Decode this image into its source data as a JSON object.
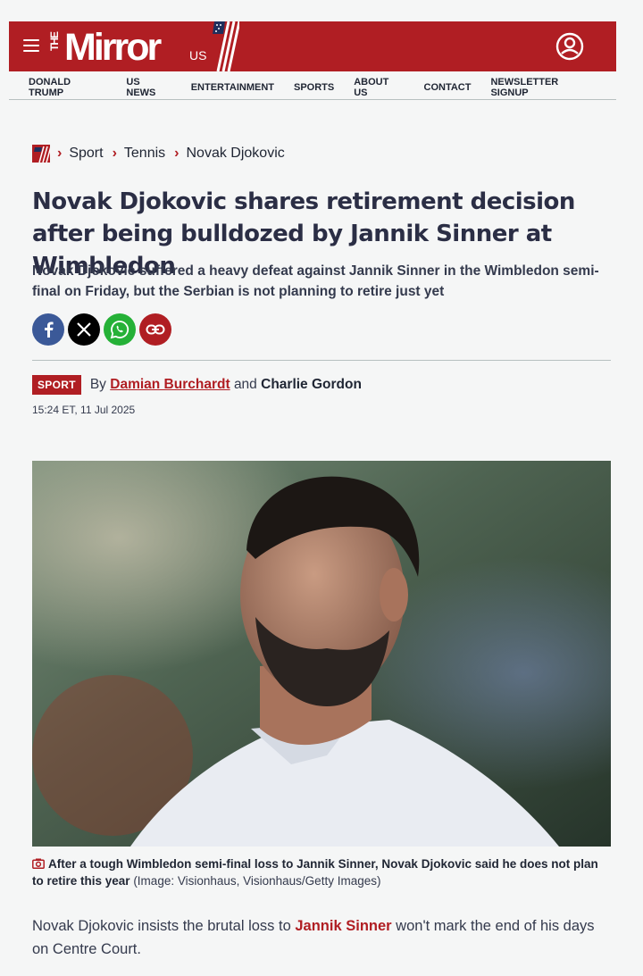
{
  "brand": {
    "logo_the": "THE",
    "logo_main": "Mirror",
    "logo_suffix": "US",
    "accent_color": "#b01e23"
  },
  "icons": {
    "menu": "hamburger-icon",
    "account": "user-account-icon",
    "home": "mirror-home-icon",
    "facebook": "facebook-icon",
    "x": "x-icon",
    "whatsapp": "whatsapp-icon",
    "link": "link-icon",
    "camera": "camera-icon"
  },
  "nav": {
    "items": [
      "DONALD TRUMP",
      "US NEWS",
      "ENTERTAINMENT",
      "SPORTS",
      "ABOUT US",
      "CONTACT",
      "NEWSLETTER SIGNUP"
    ]
  },
  "breadcrumb": {
    "items": [
      "Sport",
      "Tennis",
      "Novak Djokovic"
    ]
  },
  "article": {
    "headline": "Novak Djokovic shares retirement decision after being bulldozed by Jannik Sinner at Wimbledon",
    "standfirst": "Novak Djokovic suffered a heavy defeat against Jannik Sinner in the Wimbledon semi-final on Friday, but the Serbian is not planning to retire just yet",
    "section_badge": "SPORT",
    "by_prefix": "By",
    "author_1": "Damian Burchardt",
    "and_text": "and",
    "author_2": "Charlie Gordon",
    "timestamp": "15:24 ET, 11 Jul 2025",
    "caption_main": "After a tough Wimbledon semi-final loss to Jannik Sinner, Novak Djokovic said he does not plan to retire this year",
    "caption_credit": "(Image: Visionhaus, Visionhaus/Getty Images)",
    "para_1_before": "Novak Djokovic insists the brutal loss to",
    "para_1_link": "Jannik Sinner",
    "para_1_after": "won't mark the end of his days on Centre Court."
  }
}
